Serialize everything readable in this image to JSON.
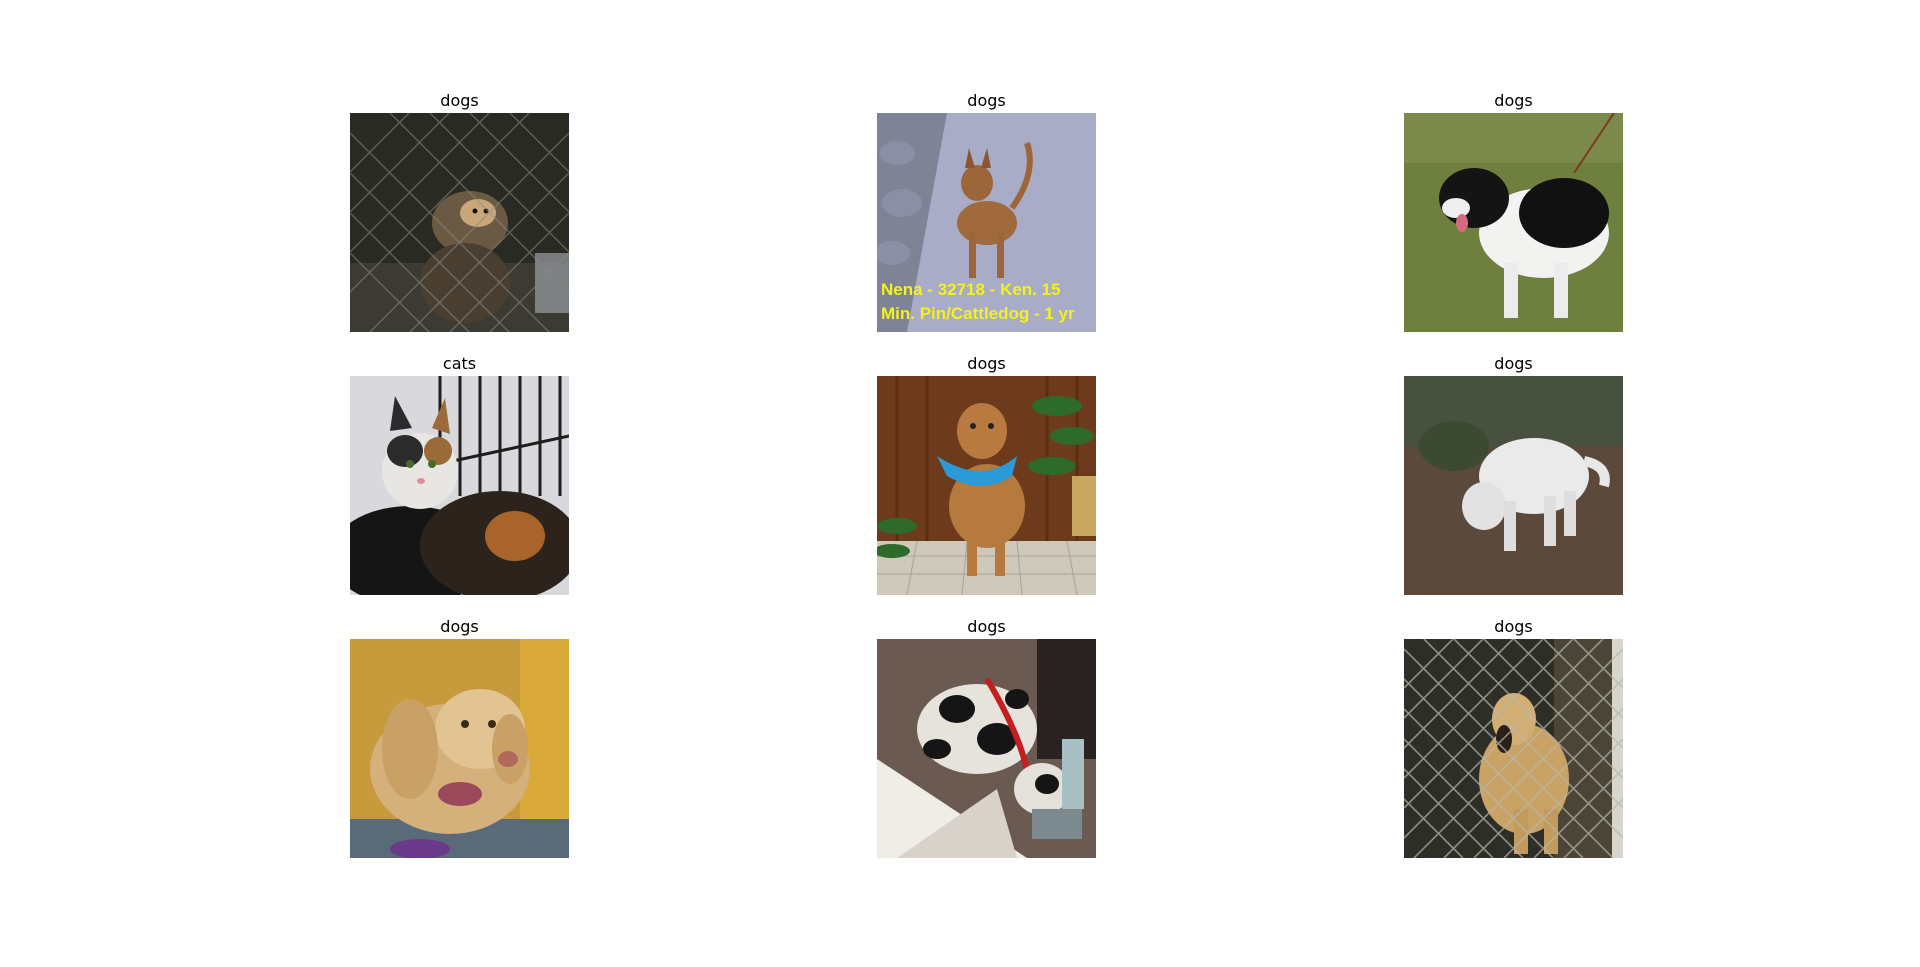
{
  "panels": [
    {
      "label": "dogs"
    },
    {
      "label": "dogs",
      "overlay_text": [
        "Nena - 32718 - Ken. 15",
        "Min. Pin/Cattledog - 1 yr"
      ]
    },
    {
      "label": "dogs"
    },
    {
      "label": "cats"
    },
    {
      "label": "dogs"
    },
    {
      "label": "dogs"
    },
    {
      "label": "dogs"
    },
    {
      "label": "dogs"
    },
    {
      "label": "dogs"
    }
  ]
}
